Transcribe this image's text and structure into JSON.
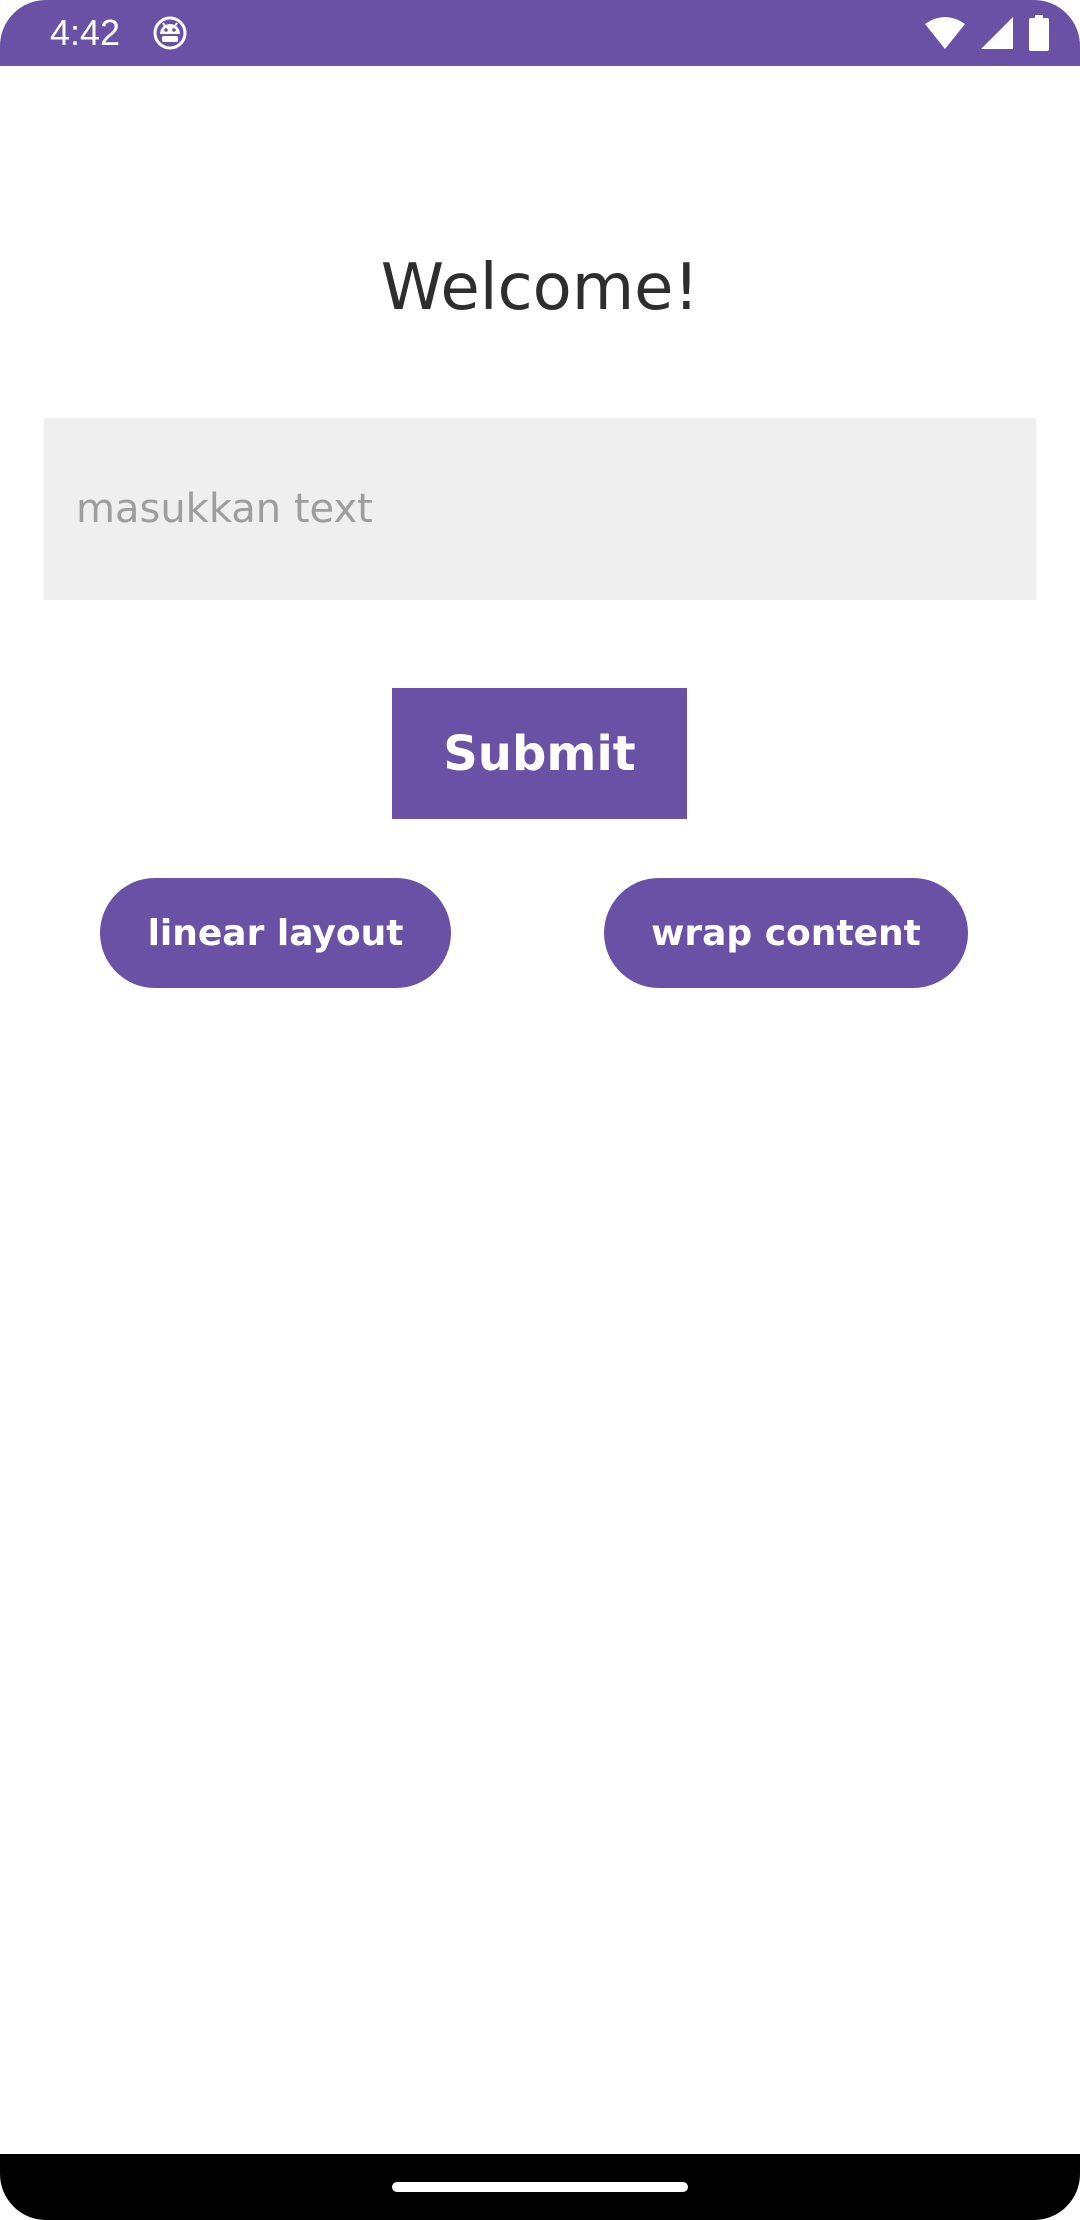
{
  "status_bar": {
    "time": "4:42",
    "app_icon": "android-debug-icon",
    "icons": [
      "wifi-icon",
      "cell-signal-icon",
      "battery-icon"
    ],
    "background_color": "#6a51a5"
  },
  "main": {
    "title": "Welcome!",
    "input": {
      "value": "",
      "placeholder": "masukkan text"
    },
    "submit_label": "Submit",
    "buttons": [
      {
        "label": "linear layout"
      },
      {
        "label": "wrap content"
      }
    ]
  },
  "colors": {
    "accent": "#6a51a5",
    "field_background": "#efefef",
    "title_text": "#2e2e2e",
    "placeholder_text": "#9e9e9e"
  },
  "nav_bar": {
    "indicator": "home-indicator"
  }
}
